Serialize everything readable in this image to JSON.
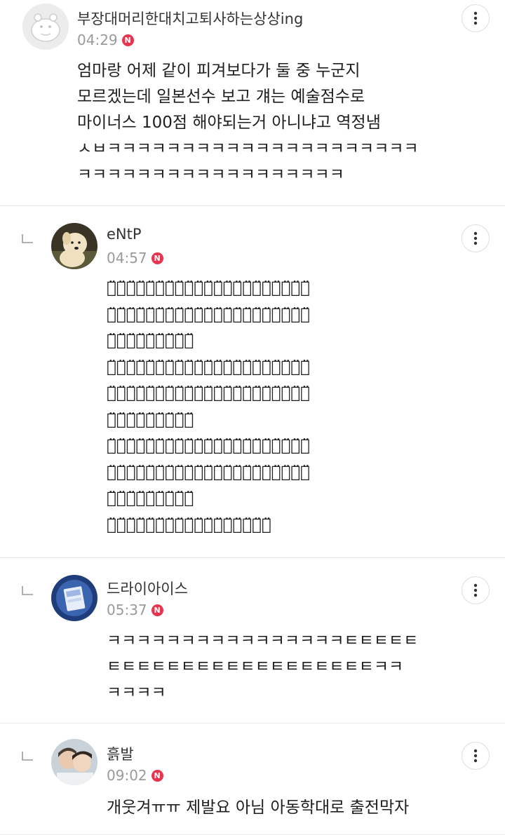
{
  "comments": [
    {
      "name": "부장대머리한대치고퇴사하는상상ing",
      "time": "04:29",
      "badge": "N",
      "text": [
        "엄마랑 어제 같이 피겨보다가 둘 중 누군지",
        "모르겠는데 일본선수 보고 걔는 예술점수로",
        "마이너스 100점 해야되는거 아니냐고 역정냄",
        "ㅅㅂㅋㅋㅋㅋㅋㅋㅋㅋㅋㅋㅋㅋㅋㅋㅋㅋㅋㅋㅋㅋㅋ",
        "ㅋㅋㅋㅋㅋㅋㅋㅋㅋㅋㅋㅋㅋㅋㅋㅋㅋㅋ"
      ]
    },
    {
      "name": "eNtP",
      "time": "04:57",
      "badge": "N",
      "text": [
        "ㅋ̈ㅋ̈ㅋ̈ㅋ̈ㅋ̈ㅋ̈ㅋ̈ㅋ̈ㅋ̈ㅋ̈ㅋ̈ㅋ̈ㅋ̈ㅋ̈ㅋ̈ㅋ̈ㅋ̈ㅋ̈ㅋ̈ㅋ̈ㅋ̈",
        "ㅋ̈ㅋ̈ㅋ̈ㅋ̈ㅋ̈ㅋ̈ㅋ̈ㅋ̈ㅋ̈ㅋ̈ㅋ̈ㅋ̈ㅋ̈ㅋ̈ㅋ̈ㅋ̈ㅋ̈ㅋ̈ㅋ̈ㅋ̈ㅋ̈",
        "ㅋ̈ㅋ̈ㅋ̈ㅋ̈ㅋ̈ㅋ̈ㅋ̈ㅋ̈ㅋ̈",
        "ㅋ̈ㅋ̈ㅋ̈ㅋ̈ㅋ̈ㅋ̈ㅋ̈ㅋ̈ㅋ̈ㅋ̈ㅋ̈ㅋ̈ㅋ̈ㅋ̈ㅋ̈ㅋ̈ㅋ̈ㅋ̈ㅋ̈ㅋ̈ㅋ̈",
        "ㅋ̈ㅋ̈ㅋ̈ㅋ̈ㅋ̈ㅋ̈ㅋ̈ㅋ̈ㅋ̈ㅋ̈ㅋ̈ㅋ̈ㅋ̈ㅋ̈ㅋ̈ㅋ̈ㅋ̈ㅋ̈ㅋ̈ㅋ̈ㅋ̈",
        "ㅋ̈ㅋ̈ㅋ̈ㅋ̈ㅋ̈ㅋ̈ㅋ̈ㅋ̈ㅋ̈",
        "ㅋ̈ㅋ̈ㅋ̈ㅋ̈ㅋ̈ㅋ̈ㅋ̈ㅋ̈ㅋ̈ㅋ̈ㅋ̈ㅋ̈ㅋ̈ㅋ̈ㅋ̈ㅋ̈ㅋ̈ㅋ̈ㅋ̈ㅋ̈ㅋ̈",
        "ㅋ̈ㅋ̈ㅋ̈ㅋ̈ㅋ̈ㅋ̈ㅋ̈ㅋ̈ㅋ̈ㅋ̈ㅋ̈ㅋ̈ㅋ̈ㅋ̈ㅋ̈ㅋ̈ㅋ̈ㅋ̈ㅋ̈ㅋ̈ㅋ̈",
        "ㅋ̈ㅋ̈ㅋ̈ㅋ̈ㅋ̈ㅋ̈ㅋ̈ㅋ̈ㅋ̈",
        "ㅋ̈ㅋ̈ㅋ̈ㅋ̈ㅋ̈ㅋ̈ㅋ̈ㅋ̈ㅋ̈ㅋ̈ㅋ̈ㅋ̈ㅋ̈ㅋ̈ㅋ̈ㅋ̈ㅋ̈"
      ]
    },
    {
      "name": "드라이아이스",
      "time": "05:37",
      "badge": "N",
      "text": [
        "ㅋㅋㅋㅋㅋㅋㅋㅋㅋㅋㅋㅋㅋㅋㅋㅋㅌㅌㅌㅌㅌ",
        "ㅌㅌㅌㅌㅌㅌㅌㅌㅌㅌㅌㅌㅌㅌㅌㅌㅌㅌㅋㅋ",
        "ㅋㅋㅋㅋ"
      ]
    },
    {
      "name": "흙발",
      "time": "09:02",
      "badge": "N",
      "text": [
        "개웃겨ㅠㅠ 제발요 아님 아동학대로 출전막자"
      ]
    }
  ],
  "icons": {
    "more": "more-vertical-icon",
    "reply": "reply-arrow-icon",
    "badge_color": "#e8344e"
  }
}
